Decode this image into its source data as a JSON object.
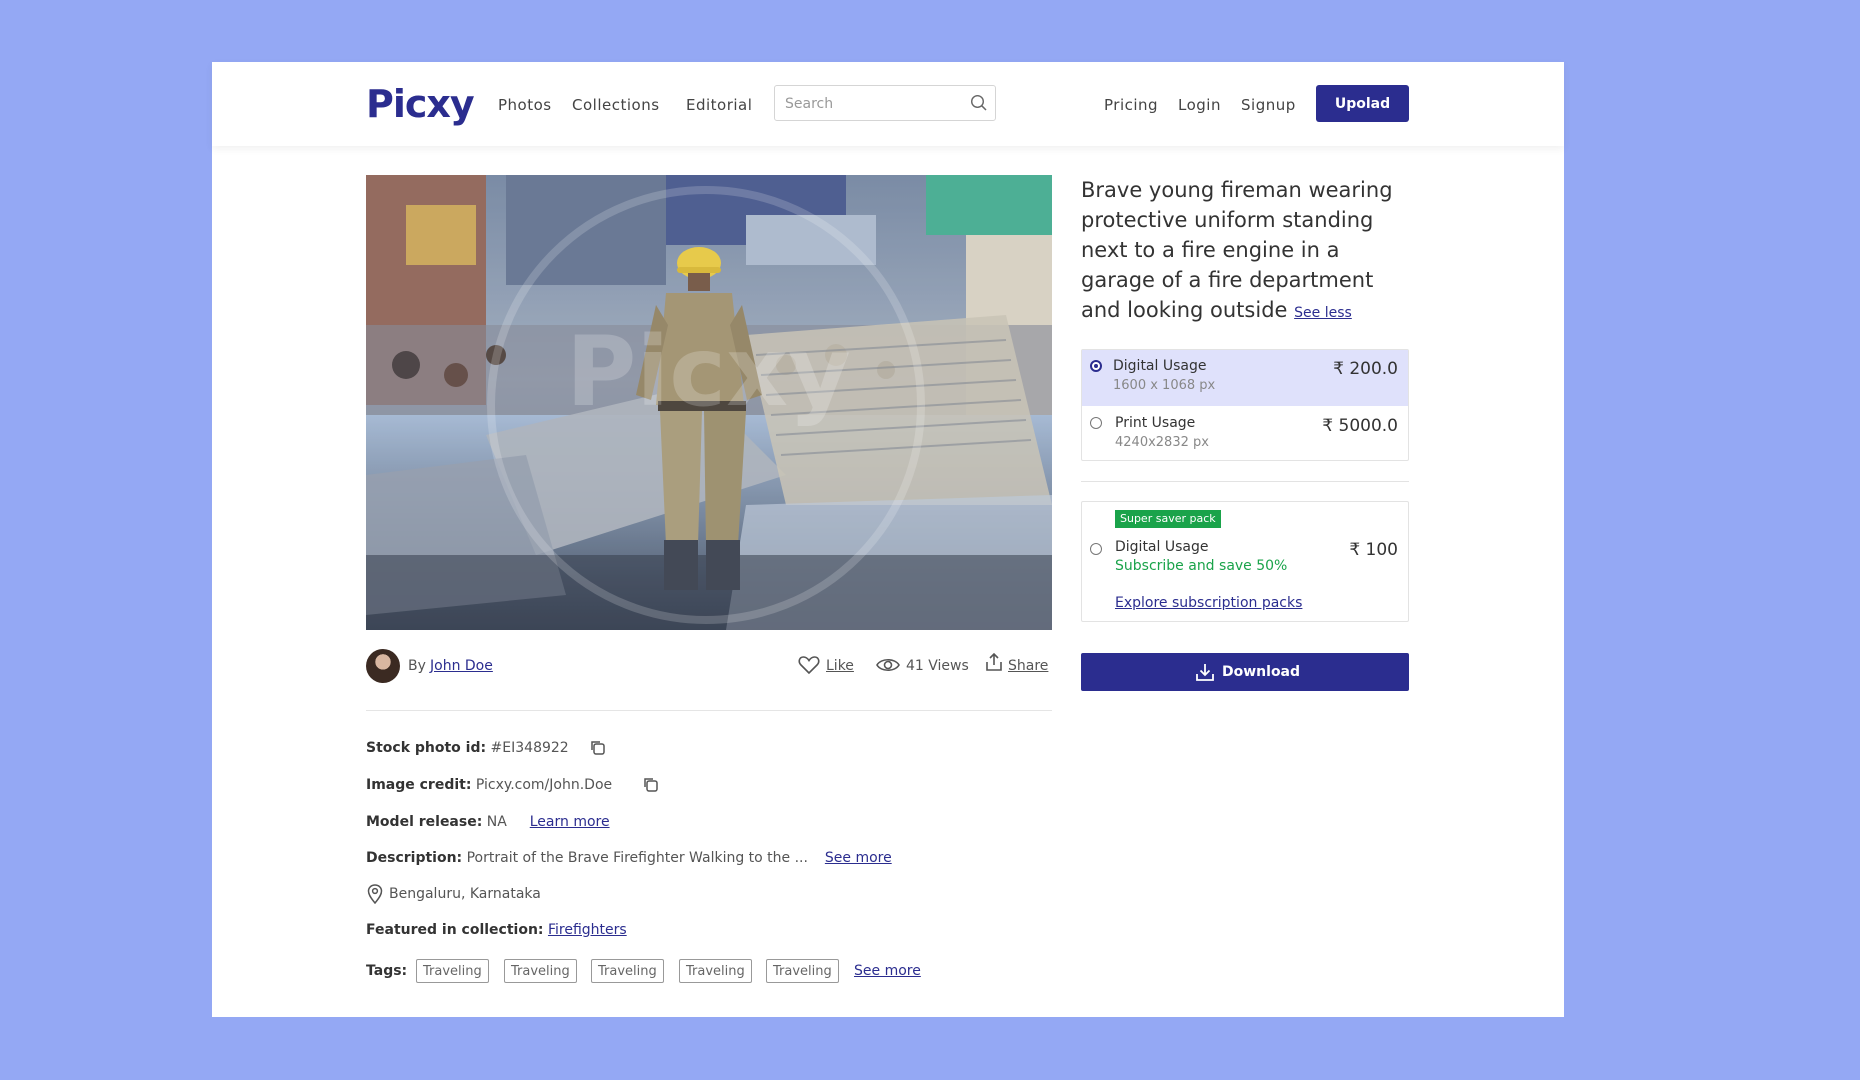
{
  "header": {
    "logo": "Picxy",
    "nav": [
      "Photos",
      "Collections",
      "Editorial"
    ],
    "search_placeholder": "Search",
    "right_links": [
      "Pricing",
      "Login",
      "Signup"
    ],
    "upload_label": "Upolad"
  },
  "photo": {
    "watermark": "Picxy",
    "title": "Brave young fireman wearing protective uniform standing next to a fire engine in a garage of a fire department and looking outside",
    "see_less": "See less",
    "by_label": "By",
    "author": "John Doe",
    "like_label": "Like",
    "views_label": "41 Views",
    "share_label": "Share"
  },
  "details": {
    "stock_id_label": "Stock photo id:",
    "stock_id_value": "#EI348922",
    "credit_label": "Image credit:",
    "credit_value": "Picxy.com/John.Doe",
    "model_label": "Model release:",
    "model_value": "NA",
    "learn_more": "Learn more",
    "description_label": "Description:",
    "description_value": "Portrait of the Brave Firefighter Walking to the ...",
    "see_more": "See more",
    "location": "Bengaluru, Karnataka",
    "collection_label": "Featured in collection:",
    "collection_value": "Firefighters",
    "tags_label": "Tags:",
    "tags": [
      "Traveling",
      "Traveling",
      "Traveling",
      "Traveling",
      "Traveling"
    ],
    "tags_see_more": "See more"
  },
  "pricing": {
    "options": [
      {
        "name": "Digital Usage",
        "dimensions": "1600 x 1068 px",
        "price": "₹ 200.0",
        "selected": true
      },
      {
        "name": "Print Usage",
        "dimensions": "4240x2832 px",
        "price": "₹ 5000.0",
        "selected": false
      }
    ],
    "saver": {
      "badge": "Super saver pack",
      "name": "Digital Usage",
      "subtitle": "Subscribe and save 50%",
      "price": "₹ 100",
      "explore_link": "Explore subscription packs"
    },
    "download_label": "Download"
  },
  "colors": {
    "brand": "#2b2d8f",
    "background": "#94a8f4",
    "accent_green": "#1aa34a",
    "selected_option_bg": "#dfe1fb"
  }
}
